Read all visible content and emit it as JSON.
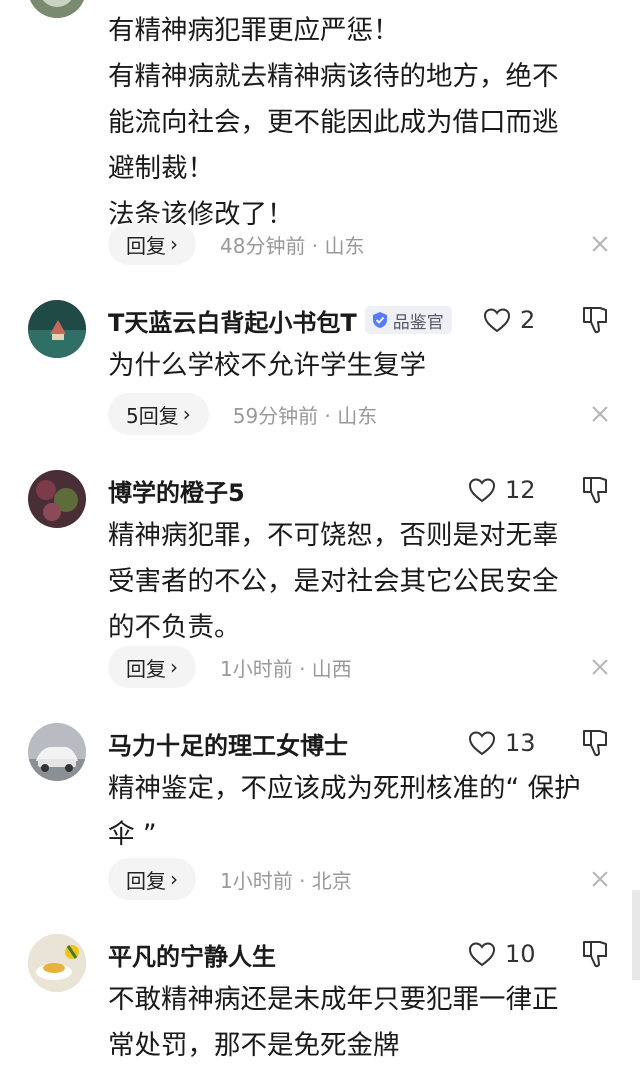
{
  "comments": [
    {
      "lines": [
        "有精神病犯罪更应严惩！",
        "有精神病就去精神病该待的地方，绝不",
        "能流向社会，更不能因此成为借口而逃",
        "避制裁！",
        "法条该修改了！"
      ],
      "reply_label": "回复",
      "time_location": "48分钟前 · 山东"
    },
    {
      "username": "T天蓝云白背起小书包T",
      "badge": "品鉴官",
      "likes": "2",
      "lines": [
        "为什么学校不允许学生复学"
      ],
      "reply_label": "5回复",
      "time_location": "59分钟前 · 山东"
    },
    {
      "username": "博学的橙子5",
      "likes": "12",
      "lines": [
        "精神病犯罪，不可饶恕，否则是对无辜",
        "受害者的不公，是对社会其它公民安全",
        "的不负责。"
      ],
      "reply_label": "回复",
      "time_location": "1小时前 · 山西"
    },
    {
      "username": "马力十足的理工女博士",
      "likes": "13",
      "lines": [
        "精神鉴定，不应该成为死刑核准的“ 保护",
        "伞 ”"
      ],
      "reply_label": "回复",
      "time_location": "1小时前 · 北京"
    },
    {
      "username": "平凡的宁静人生",
      "likes": "10",
      "lines": [
        "不敢精神病还是未成年只要犯罪一律正",
        "常处罚，那不是免死金牌"
      ]
    }
  ],
  "icons": {
    "heart": "heart-outline-icon",
    "dislike": "thumbs-down-outline-icon",
    "close": "close-icon",
    "badge": "shield-check-icon",
    "chevron": "chevron-right-icon"
  },
  "colors": {
    "meta_text": "#999999",
    "badge_bg": "#eef0f6",
    "badge_icon": "#5b7cfa",
    "reply_bg": "#f4f4f4"
  }
}
